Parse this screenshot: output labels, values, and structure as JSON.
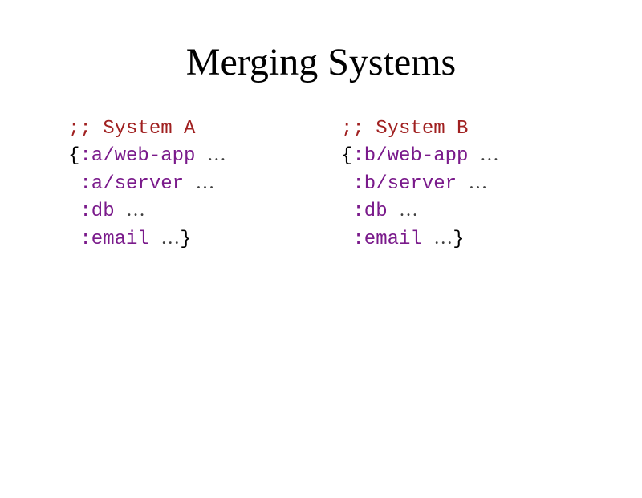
{
  "title": "Merging Systems",
  "systemA": {
    "comment": ";; System A",
    "open": "{",
    "k1": ":a/web-app",
    "k2": ":a/server",
    "k3": ":db",
    "k4": ":email",
    "close": "}"
  },
  "systemB": {
    "comment": ";; System B",
    "open": "{",
    "k1": ":b/web-app",
    "k2": ":b/server",
    "k3": ":db",
    "k4": ":email",
    "close": "}"
  },
  "ellipsis": "…"
}
